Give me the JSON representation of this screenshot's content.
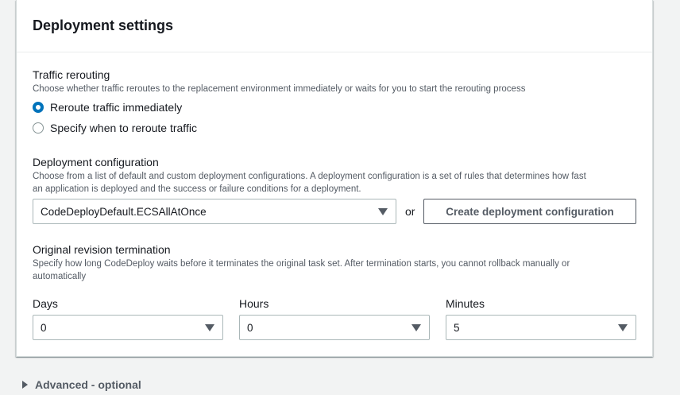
{
  "panel": {
    "title": "Deployment settings"
  },
  "traffic": {
    "label": "Traffic rerouting",
    "description": "Choose whether traffic reroutes to the replacement environment immediately or waits for you to start the rerouting process",
    "options": [
      {
        "label": "Reroute traffic immediately",
        "selected": true
      },
      {
        "label": "Specify when to reroute traffic",
        "selected": false
      }
    ]
  },
  "deployment_config": {
    "label": "Deployment configuration",
    "description_line1": "Choose from a list of default and custom deployment configurations. A deployment configuration is a set of rules that determines how fast",
    "description_line2": "an application is deployed and the success or failure conditions for a deployment.",
    "selected_value": "CodeDeployDefault.ECSAllAtOnce",
    "or_text": "or",
    "create_button_label": "Create deployment configuration"
  },
  "termination": {
    "label": "Original revision termination",
    "description_line1": "Specify how long CodeDeploy waits before it terminates the original task set. After termination starts, you cannot rollback manually or",
    "description_line2": "automatically",
    "days": {
      "label": "Days",
      "value": "0"
    },
    "hours": {
      "label": "Hours",
      "value": "0"
    },
    "minutes": {
      "label": "Minutes",
      "value": "5"
    }
  },
  "advanced": {
    "label": "Advanced - optional"
  },
  "colors": {
    "accent": "#0073bb",
    "border": "#aab7b8",
    "text": "#16191f",
    "muted": "#545b64"
  }
}
